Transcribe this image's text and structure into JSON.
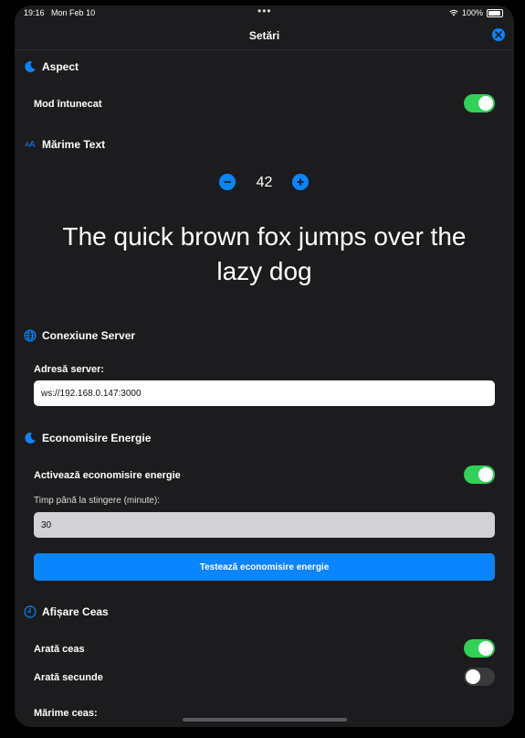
{
  "status": {
    "time": "19:16",
    "date": "Mon Feb 10",
    "battery": "100%"
  },
  "nav": {
    "title": "Setări"
  },
  "appearance": {
    "title": "Aspect",
    "dark_mode_label": "Mod întunecat",
    "dark_mode_on": true
  },
  "text_size": {
    "title": "Mărime Text",
    "value": "42",
    "sample": "The quick brown fox jumps over the lazy dog"
  },
  "server": {
    "title": "Conexiune Server",
    "address_label": "Adresă server:",
    "address_value": "ws://192.168.0.147:3000"
  },
  "energy": {
    "title": "Economisire Energie",
    "enable_label": "Activează economisire energie",
    "enable_on": true,
    "timeout_label": "Timp până la stingere (minute):",
    "timeout_value": "30",
    "test_button": "Testează economisire energie"
  },
  "clock": {
    "title": "Afișare Ceas",
    "show_clock_label": "Arată ceas",
    "show_clock_on": true,
    "show_seconds_label": "Arată secunde",
    "show_seconds_on": false,
    "size_label": "Mărime ceas:"
  },
  "colors": {
    "accent": "#0a84ff",
    "toggle_on": "#30d158",
    "background": "#1c1c1e"
  }
}
